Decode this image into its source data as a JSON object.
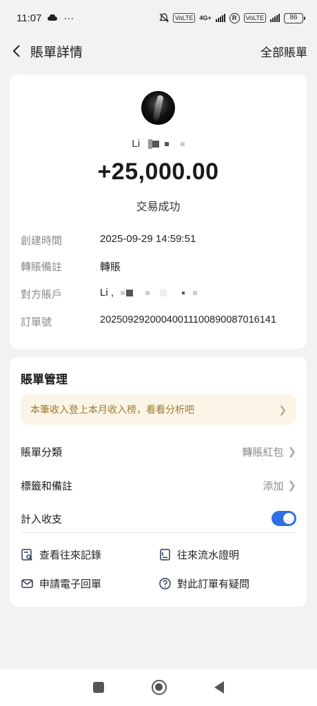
{
  "status_bar": {
    "time": "11:07",
    "more": "···",
    "network": "4G+",
    "chip1": "VoLTE",
    "roaming": "R",
    "battery": "86"
  },
  "header": {
    "title": "賬單詳情",
    "right_link": "全部賬單"
  },
  "detail": {
    "payer_name": "Li",
    "amount": "+25,000.00",
    "status": "交易成功",
    "rows": [
      {
        "label": "創建時間",
        "value": "2025-09-29 14:59:51"
      },
      {
        "label": "轉賬備註",
        "value": "轉賬"
      },
      {
        "label": "對方賬戶",
        "value": "Li ,"
      },
      {
        "label": "訂單號",
        "value": "20250929200040011100890087016141"
      }
    ]
  },
  "manage": {
    "title": "賬單管理",
    "promo": "本筆收入登上本月收入榜，看看分析吧",
    "category_label": "賬單分類",
    "category_value": "轉賬紅包",
    "tags_label": "標籤和備註",
    "tags_value": "添加",
    "count_label": "計入收支",
    "count_enabled": true,
    "actions": [
      {
        "label": "查看往來記錄",
        "icon": "records-search-icon"
      },
      {
        "label": "往來流水證明",
        "icon": "statement-doc-icon"
      },
      {
        "label": "申請電子回單",
        "icon": "mail-icon"
      },
      {
        "label": "對此訂單有疑問",
        "icon": "question-circle-icon"
      }
    ]
  },
  "colors": {
    "accent": "#2e6ee6",
    "promo_bg": "#fbf5e8",
    "promo_text": "#a0792a",
    "background": "#f2f2f2"
  }
}
